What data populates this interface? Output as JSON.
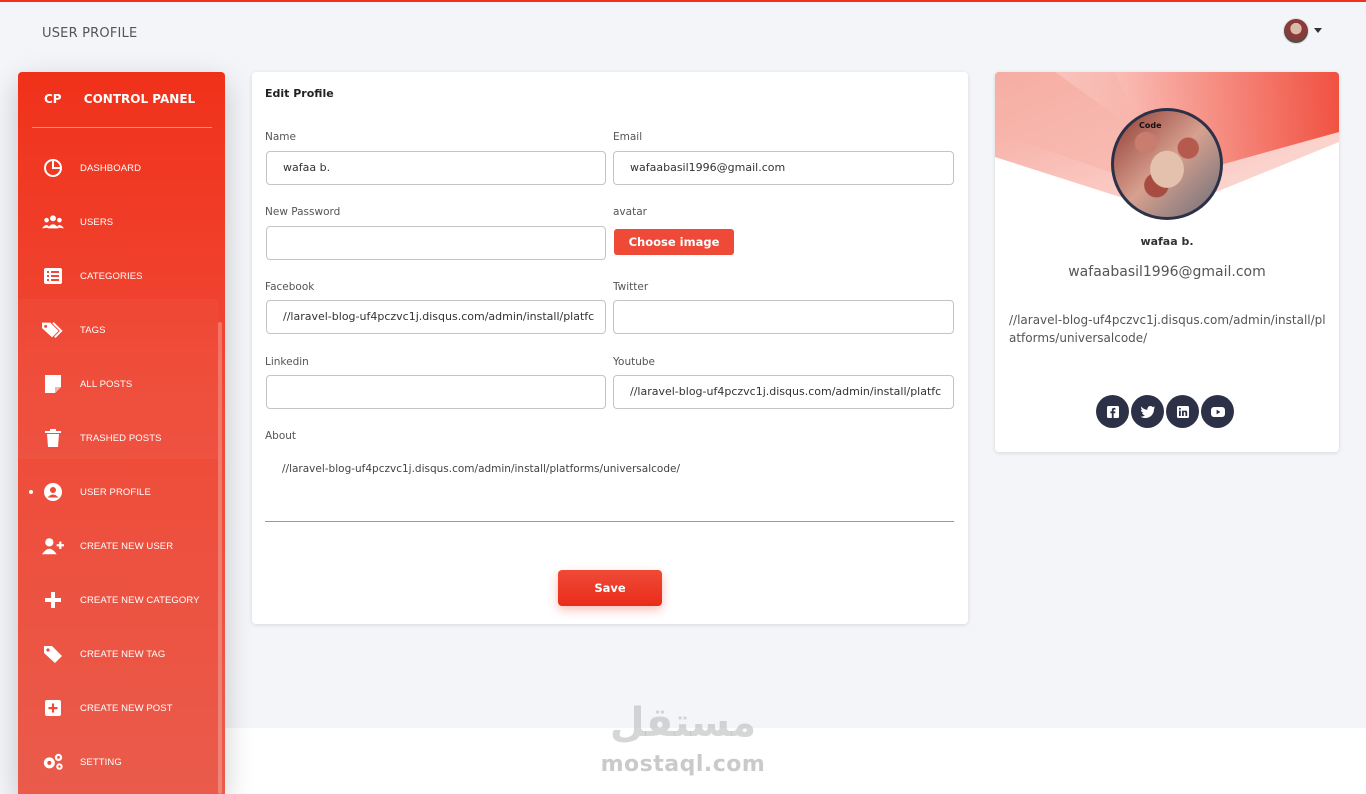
{
  "header": {
    "title": "USER PROFILE"
  },
  "sidebar": {
    "logo_mini": "CP",
    "logo_text": "CONTROL PANEL",
    "items": [
      {
        "label": "DASHBOARD",
        "icon": "pie-chart-icon",
        "active": false
      },
      {
        "label": "USERS",
        "icon": "users-icon",
        "active": false
      },
      {
        "label": "CATEGORIES",
        "icon": "list-icon",
        "active": false
      },
      {
        "label": "TAGS",
        "icon": "tags-icon",
        "active": false
      },
      {
        "label": "ALL POSTS",
        "icon": "note-icon",
        "active": false
      },
      {
        "label": "TRASHED POSTS",
        "icon": "trash-icon",
        "active": false
      },
      {
        "label": "USER PROFILE",
        "icon": "user-circle-icon",
        "active": true
      },
      {
        "label": "CREATE NEW USER",
        "icon": "user-plus-icon",
        "active": false
      },
      {
        "label": "CREATE NEW CATEGORY",
        "icon": "plus-icon",
        "active": false
      },
      {
        "label": "CREATE NEW TAG",
        "icon": "tag-icon",
        "active": false
      },
      {
        "label": "CREATE NEW POST",
        "icon": "plus-square-icon",
        "active": false
      },
      {
        "label": "SETTING",
        "icon": "gears-icon",
        "active": false
      }
    ]
  },
  "form": {
    "title": "Edit Profile",
    "name_label": "Name",
    "name_value": "wafaa b.",
    "email_label": "Email",
    "email_value": "wafaabasil1996@gmail.com",
    "password_label": "New Password",
    "password_value": "",
    "avatar_label": "avatar",
    "choose_image": "Choose image",
    "facebook_label": "Facebook",
    "facebook_value": "//laravel-blog-uf4pczvc1j.disqus.com/admin/install/platfc",
    "twitter_label": "Twitter",
    "twitter_value": "",
    "linkedin_label": "Linkedin",
    "linkedin_value": "",
    "youtube_label": "Youtube",
    "youtube_value": "//laravel-blog-uf4pczvc1j.disqus.com/admin/install/platfc",
    "about_label": "About",
    "about_value": "//laravel-blog-uf4pczvc1j.disqus.com/admin/install/platforms/universalcode/",
    "save_label": "Save"
  },
  "profile": {
    "avatar_caption": "Code",
    "name": "wafaa b.",
    "email": "wafaabasil1996@gmail.com",
    "about": "//laravel-blog-uf4pczvc1j.disqus.com/admin/install/platforms/universalcode/",
    "socials": [
      "facebook-icon",
      "twitter-icon",
      "linkedin-icon",
      "youtube-icon"
    ]
  },
  "watermark": {
    "arabic": "مستقل",
    "latin": "mostaql.com"
  },
  "colors": {
    "accent": "#ef4a37",
    "dark": "#2c3148"
  }
}
